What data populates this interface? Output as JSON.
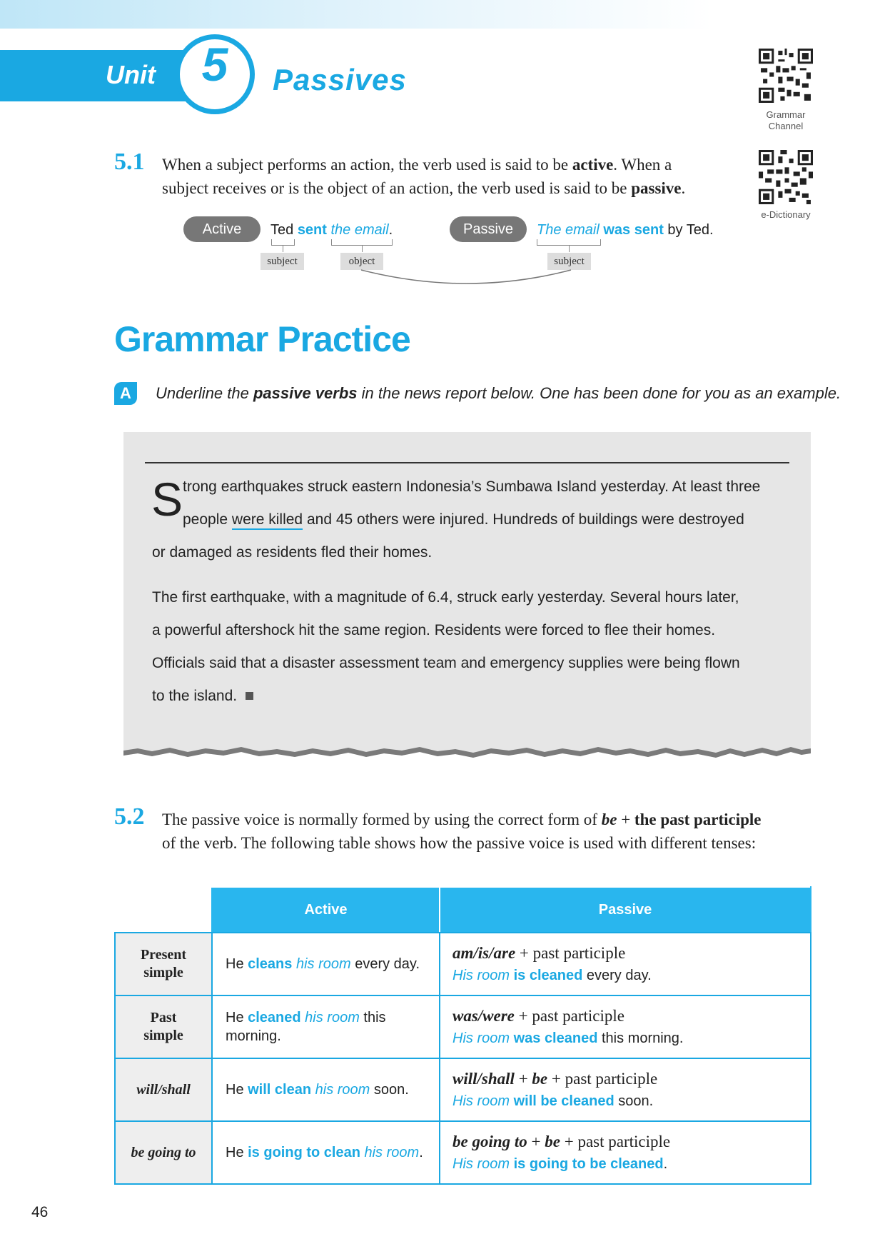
{
  "header": {
    "unit_word": "Unit",
    "unit_number": "5",
    "title": "Passives",
    "qr1_label_line1": "Grammar",
    "qr1_label_line2": "Channel",
    "qr2_label": "e-Dictionary"
  },
  "section_5_1": {
    "number": "5.1",
    "line1_a": "When a subject performs an action, the verb used is said to be ",
    "line1_b": "active",
    "line1_c": ". When a",
    "line2_a": "subject receives or is the object of an action, the verb used is said to be ",
    "line2_b": "passive",
    "line2_c": ".",
    "example": {
      "active_label": "Active",
      "active_subject": "Ted",
      "active_verb": "sent",
      "active_object": "the email",
      "active_end": ".",
      "passive_label": "Passive",
      "passive_subject": "The email",
      "passive_verb": "was sent",
      "passive_rest": " by Ted.",
      "tag_subject": "subject",
      "tag_object": "object",
      "tag_subject2": "subject"
    }
  },
  "grammar_practice": {
    "title": "Grammar Practice",
    "exercise_letter": "A",
    "instruction_a": "Underline the ",
    "instruction_b": "passive verbs",
    "instruction_c": " in the news report below. One has been done for you as an example."
  },
  "news": {
    "dropcap": "S",
    "l1": "trong earthquakes struck eastern Indonesia’s Sumbawa Island yesterday. At least three",
    "l2_a": "people ",
    "l2_b": "were killed",
    "l2_c": " and 45 others were injured. Hundreds of buildings were destroyed",
    "l3": "or damaged as residents fled their homes.",
    "p2_l1": "The first earthquake, with a magnitude of 6.4, struck early yesterday. Several hours later,",
    "p2_l2": "a powerful aftershock hit the same region. Residents were forced to flee their homes.",
    "p2_l3": "Officials said that a disaster assessment team and emergency supplies were being flown",
    "p2_l4": "to the island."
  },
  "section_5_2": {
    "number": "5.2",
    "line1_a": "The passive voice is normally formed by using the correct form of ",
    "line1_b": "be",
    "line1_c": " + ",
    "line1_d": "the past participle",
    "line2": "of the verb. The following table shows how the passive voice is used with different tenses:"
  },
  "table": {
    "col_active": "Active",
    "col_passive": "Passive",
    "rows": [
      {
        "tense_l1": "Present",
        "tense_l2": "simple",
        "act_a": "He ",
        "act_b": "cleans",
        "act_c": " ",
        "act_d": "his room",
        "act_e": " every day.",
        "rule_a": "am/is/are",
        "rule_b": " + past participle",
        "ex_a": "His room",
        "ex_b": " ",
        "ex_c": "is cleaned",
        "ex_d": " every day."
      },
      {
        "tense_l1": "Past",
        "tense_l2": "simple",
        "act_a": "He ",
        "act_b": "cleaned",
        "act_c": " ",
        "act_d": "his room",
        "act_e": " this",
        "act_f": "morning.",
        "rule_a": "was/were",
        "rule_b": " + past participle",
        "ex_a": "His room",
        "ex_b": " ",
        "ex_c": "was cleaned",
        "ex_d": " this morning."
      },
      {
        "tense": "will/shall",
        "act_a": "He ",
        "act_b": "will clean",
        "act_c": " ",
        "act_d": "his room",
        "act_e": " soon.",
        "rule_a": "will/shall",
        "rule_b": " + ",
        "rule_c": "be",
        "rule_d": " + past participle",
        "ex_a": "His room",
        "ex_b": " ",
        "ex_c": "will be cleaned",
        "ex_d": " soon."
      },
      {
        "tense": "be going to",
        "act_a": "He ",
        "act_b": "is going to clean",
        "act_c": " ",
        "act_d": "his room",
        "act_e": ".",
        "rule_a": "be going to",
        "rule_b": " + ",
        "rule_c": "be",
        "rule_d": " + past participle",
        "ex_a": "His room",
        "ex_b": " ",
        "ex_c": "is going to be cleaned",
        "ex_d": "."
      }
    ]
  },
  "footer": {
    "page_number": "46"
  },
  "colors": {
    "accent": "#1aa8e2",
    "table_header": "#29b6ee",
    "box_gray": "#e6e6e6"
  }
}
